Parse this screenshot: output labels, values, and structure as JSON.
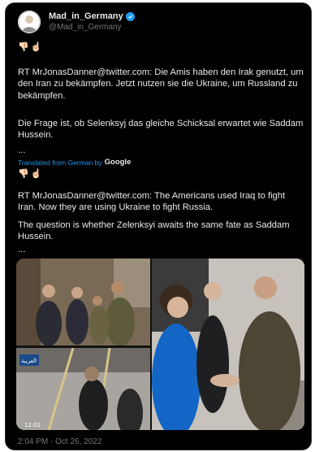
{
  "tweet": {
    "display_name": "Mad_in_Germany",
    "handle": "@Mad_in_Germany",
    "emoji_top": "👎🏻☝🏻",
    "original_p1": "RT MrJonasDanner@twitter.com: Die Amis haben den Irak genutzt, um den Iran zu bekämpfen. Jetzt nutzen sie die Ukraine, um Russland zu bekämpfen.",
    "original_p2": "Die Frage ist, ob Selenksyj das gleiche Schicksal erwartet wie Saddam Hussein.",
    "ellipsis": "...",
    "translated_label": "Translated from German by",
    "translator": "Google",
    "emoji_translated": "👎🏻☝🏻",
    "translated_p1": "RT MrJonasDanner@twitter.com: The Americans used Iraq to fight Iran. Now they are using Ukraine to fight Russia.",
    "translated_p2": "The question is whether Zelenksyi awaits the same fate as Saddam Hussein.",
    "ellipsis2": "...",
    "timestamp": "2:04 PM · Oct 26, 2022"
  },
  "colors": {
    "background": "#000000",
    "text": "#e7e9ea",
    "secondary": "#71767b",
    "accent": "#1d9bf0"
  },
  "icons": [
    "verified-badge-icon",
    "google-logo"
  ],
  "media_overlay_text": [
    "العربية",
    "12:01"
  ]
}
